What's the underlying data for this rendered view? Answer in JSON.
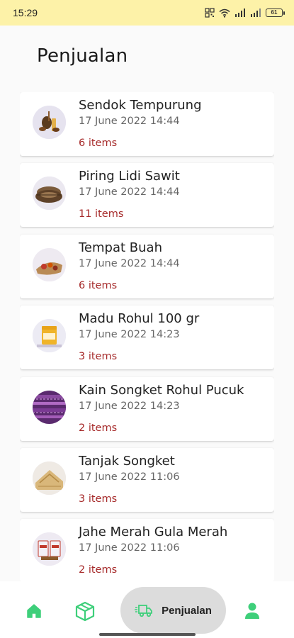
{
  "status_bar": {
    "time": "15:29",
    "battery": "61"
  },
  "page": {
    "title": "Penjualan"
  },
  "sales": [
    {
      "name": "Sendok Tempurung",
      "date": "17 June 2022 14:44",
      "count": "6 items",
      "thumb": "wooden-spoons"
    },
    {
      "name": "Piring Lidi Sawit",
      "date": "17 June 2022 14:44",
      "count": "11 items",
      "thumb": "woven-plates"
    },
    {
      "name": "Tempat Buah",
      "date": "17 June 2022 14:44",
      "count": "6 items",
      "thumb": "fruit-basket"
    },
    {
      "name": "Madu Rohul 100 gr",
      "date": "17 June 2022 14:23",
      "count": "3 items",
      "thumb": "honey-jar"
    },
    {
      "name": "Kain Songket Rohul Pucuk",
      "date": "17 June 2022 14:23",
      "count": "2 items",
      "thumb": "songket-cloth"
    },
    {
      "name": "Tanjak Songket",
      "date": "17 June 2022 11:06",
      "count": "3 items",
      "thumb": "tanjak-headwear"
    },
    {
      "name": "Jahe Merah Gula Merah",
      "date": "17 June 2022 11:06",
      "count": "2 items",
      "thumb": "ginger-packs"
    }
  ],
  "bottom_nav": {
    "active_label": "Penjualan",
    "items": [
      "home-icon",
      "box-icon",
      "delivery-truck-icon",
      "person-icon"
    ],
    "accent_color": "#3ecf7a",
    "active_bg": "#dcdcdc"
  },
  "colors": {
    "status_bar_bg": "#fdf2a8",
    "item_count": "#a62a2a"
  }
}
